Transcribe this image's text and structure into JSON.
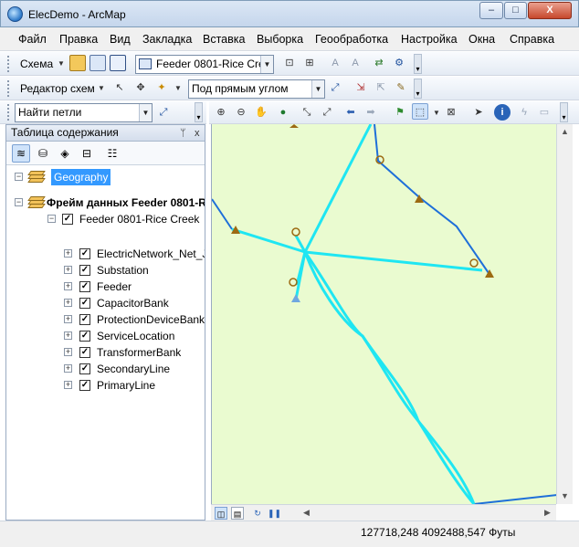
{
  "window": {
    "title": "ElecDemo - ArcMap",
    "controls": {
      "minimize": "–",
      "maximize": "□",
      "close": "X"
    }
  },
  "menu": {
    "items": [
      "Файл",
      "Правка",
      "Вид",
      "Закладка",
      "Вставка",
      "Выборка",
      "Геообработка",
      "Настройка",
      "Окна",
      "Справка"
    ]
  },
  "toolbar1": {
    "schema_label": "Схема",
    "feeder_combo": "Feeder 0801-Rice Cre"
  },
  "toolbar2": {
    "editor_label": "Редактор схем",
    "angle_combo": "Под прямым углом"
  },
  "toolbar3": {
    "find_combo": "Найти петли"
  },
  "toc": {
    "title": "Таблица содержания",
    "pin": "ᛘ",
    "close": "x",
    "geography": "Geography",
    "data_frame": "Фрейм данных Feeder 0801-R",
    "feeder": "Feeder 0801-Rice Creek",
    "layers": [
      "ElectricNetwork_Net_J",
      "Substation",
      "Feeder",
      "CapacitorBank",
      "ProtectionDeviceBank",
      "ServiceLocation",
      "TransformerBank",
      "SecondaryLine",
      "PrimaryLine"
    ]
  },
  "status": {
    "coordinates": "127718,248  4092488,547 Футы"
  },
  "colors": {
    "map_background": "#eafbd0",
    "primary_line": "#1fe6f2",
    "secondary_line": "#1e6fd9",
    "transformer": "#9c6a12",
    "service": "#c7a070",
    "selection": "#3399ff"
  }
}
